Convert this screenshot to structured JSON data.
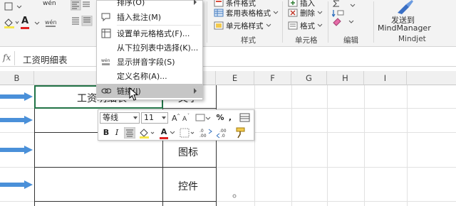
{
  "ribbon": {
    "wen_label": "wén",
    "font_color_glyph": "A",
    "sort_label": "排序(O)",
    "insert_comment": "插入批注(M)",
    "conditional_format": "条件格式",
    "table_format": "套用表格格式",
    "cell_style": "单元格样式",
    "insert": "插入",
    "delete": "删除",
    "format": "格式",
    "send_to": "发送到",
    "mindmanager": "MindManager",
    "groups": {
      "styles": "样式",
      "cells": "单元格",
      "editing": "编辑",
      "mindjet": "Mindjet"
    }
  },
  "formula_bar": {
    "fx": "fx",
    "content": "工资明细表"
  },
  "columns": [
    "B",
    "E",
    "F",
    "G",
    "H",
    "I"
  ],
  "table": {
    "c1": "工资明细表",
    "d1": "文字",
    "d3": "图标",
    "d4": "控件"
  },
  "context_menu": {
    "items": [
      {
        "label": "排序(O)"
      },
      {
        "label": "插入批注(M)"
      },
      {
        "label": "设置单元格格式(F)..."
      },
      {
        "label": "从下拉列表中选择(K)..."
      },
      {
        "label": "显示拼音字段(S)"
      },
      {
        "label": "定义名称(A)..."
      },
      {
        "label": "链接(I)"
      }
    ]
  },
  "mini_toolbar": {
    "font_name": "等线",
    "font_size": "11",
    "bold": "B",
    "italic": "I",
    "percent": "%",
    "comma": ",",
    "font_color": "A"
  },
  "colors": {
    "arrow": "#4a90d9",
    "selected_border": "#217346",
    "font_red": "#e02020"
  }
}
